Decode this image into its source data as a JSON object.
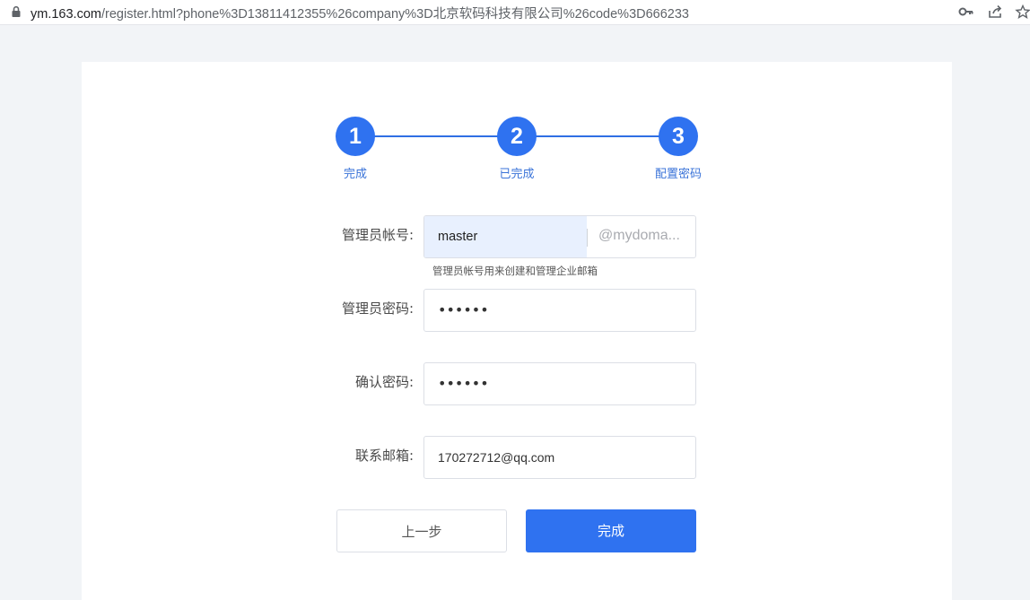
{
  "browser": {
    "url_host": "ym.163.com",
    "url_path": "/register.html?phone%3D13811412355%26company%3D北京软码科技有限公司%26code%3D666233"
  },
  "stepper": {
    "steps": [
      {
        "number": "1",
        "label": "完成"
      },
      {
        "number": "2",
        "label": "已完成"
      },
      {
        "number": "3",
        "label": "配置密码"
      }
    ]
  },
  "form": {
    "account": {
      "label": "管理员帐号:",
      "value": "master",
      "domain_suffix": "@mydoma...",
      "hint": "管理员帐号用来创建和管理企业邮箱"
    },
    "password": {
      "label": "管理员密码:",
      "masked": "••••••"
    },
    "confirm": {
      "label": "确认密码:",
      "masked": "••••••"
    },
    "email": {
      "label": "联系邮箱:",
      "value": "170272712@qq.com"
    }
  },
  "buttons": {
    "prev_label": "上一步",
    "finish_label": "完成"
  },
  "colors": {
    "accent": "#2f72f0",
    "autofill_bg": "#e8f0fe"
  }
}
